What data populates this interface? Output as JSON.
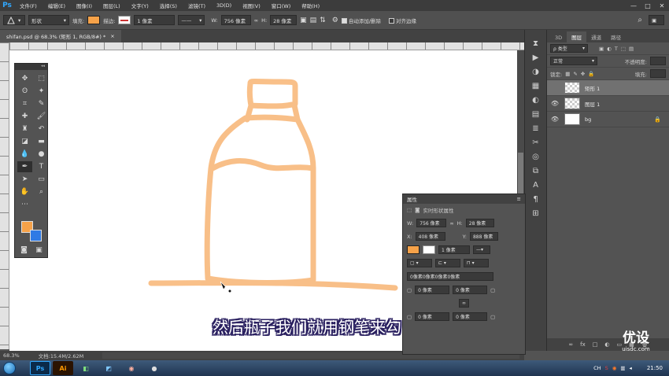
{
  "app": {
    "logo": "Ps"
  },
  "menu": [
    "文件(F)",
    "编辑(E)",
    "图像(I)",
    "图层(L)",
    "文字(Y)",
    "选择(S)",
    "滤镜(T)",
    "3D(D)",
    "视图(V)",
    "窗口(W)",
    "帮助(H)"
  ],
  "window_controls": {
    "minimize": "—",
    "maximize": "□",
    "close": "✕"
  },
  "options_bar": {
    "tool_mode": "形状",
    "fill_label": "填充:",
    "stroke_label": "描边:",
    "stroke_width": "1 像素",
    "w_label": "W:",
    "w_value": "756 像素",
    "link_icon": "∞",
    "h_label": "H:",
    "h_value": "28 像素",
    "auto_add_delete": "自动添加/删除",
    "align_edges": "对齐边缘",
    "fill_color": "#f6a249"
  },
  "document_tab": {
    "title": "shifan.psd @ 68.3% (矩形 1, RGB/8#) *",
    "close": "×"
  },
  "tools_panel": {
    "collapse": "◂◂"
  },
  "colors": {
    "foreground": "#f6a249",
    "background": "#2f7ae5",
    "stroke": "#f8b97c"
  },
  "status": {
    "zoom": "68.3%",
    "doc_info": "文档:15.4M/2.62M",
    "arrow": "▸"
  },
  "layers_panel": {
    "tabs": [
      "3D",
      "图层",
      "通道",
      "路径"
    ],
    "filter_label": "ρ 类型",
    "blend_mode": "正常",
    "opacity_label": "不透明度:",
    "lock_label": "锁定:",
    "fill_label": "填充:",
    "layers": [
      {
        "name": "矩形 1",
        "visible": false,
        "selected": true
      },
      {
        "name": "图层 1",
        "visible": true,
        "selected": false
      },
      {
        "name": "bg",
        "visible": true,
        "selected": false,
        "locked": true
      }
    ],
    "bottom_icons": [
      "fx",
      "□",
      "◐",
      "▭",
      "▦",
      "🗑"
    ]
  },
  "properties_panel": {
    "title": "属性",
    "subtitle": "实时形状属性",
    "w_label": "W:",
    "w_value": "756 像素",
    "h_label": "H:",
    "h_value": "28 像素",
    "x_label": "X:",
    "x_value": "408 像素",
    "y_label": "Y:",
    "y_value": "888 像素",
    "stroke_width": "1 像素",
    "corner_all": "0像素0像素0像素0像素",
    "corner_tl": "0 像素",
    "corner_tr": "0 像素",
    "corner_bl": "0 像素",
    "corner_br": "0 像素",
    "link_icon": "∞",
    "menu_icon": "≡",
    "collapse": "◂◂"
  },
  "subtitle": "然后瓶子我们就用钢笔来勾",
  "watermark": {
    "big": "优设",
    "small": "uisdc.com"
  },
  "taskbar": {
    "apps": [
      "Ps",
      "Ai",
      "",
      "",
      "",
      ""
    ],
    "tray_lang": "CH",
    "clock": "21:50"
  }
}
